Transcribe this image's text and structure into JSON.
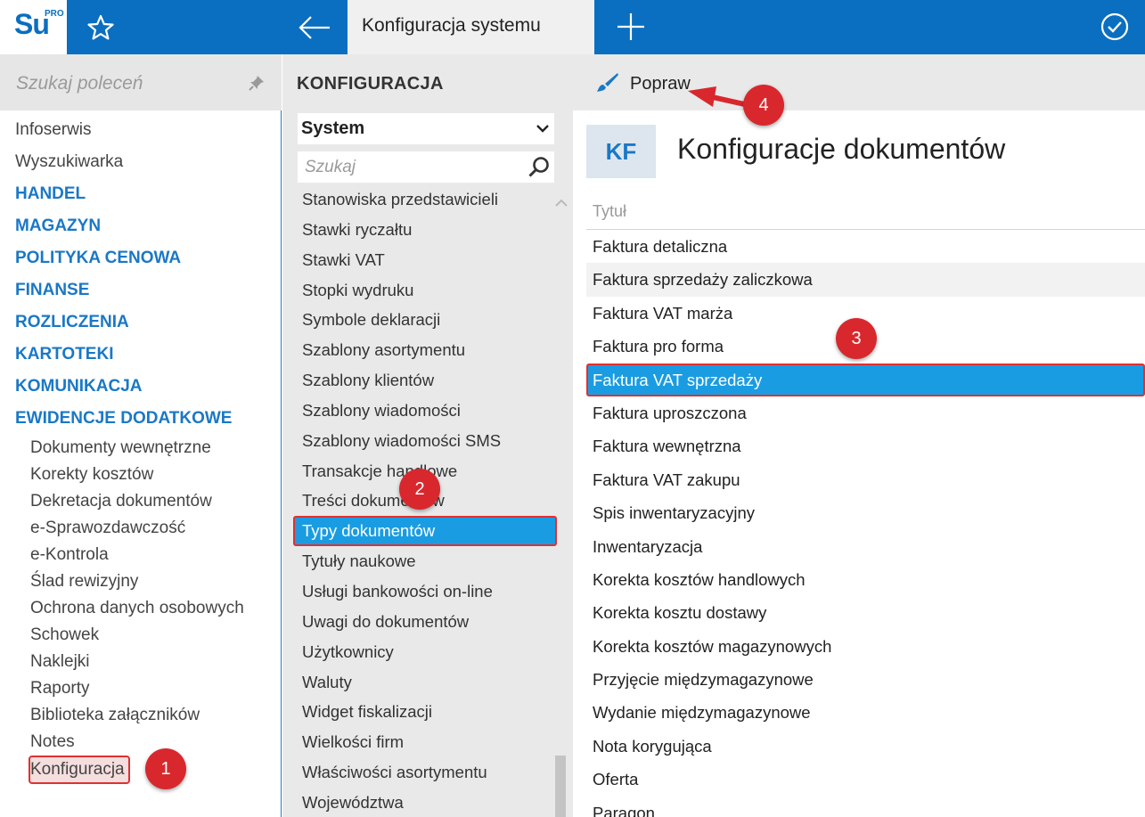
{
  "app": {
    "logo_text": "Su",
    "logo_sup": "PRO",
    "tab_title": "Konfiguracja systemu"
  },
  "icons": {
    "favorite": "star-icon",
    "back": "arrow-left-icon",
    "new_tab": "plus-icon",
    "status": "check-circle-icon",
    "pin": "pin-icon",
    "search": "magnifier-icon",
    "dropdown": "chevron-down-icon",
    "edit": "brush-icon",
    "scroll_up": "chevron-up-icon"
  },
  "colors": {
    "brand": "#0a6fc0",
    "accent": "#1a9ce2",
    "category": "#1a78c6",
    "callout": "#d8282d"
  },
  "sidebar": {
    "search_placeholder": "Szukaj poleceń",
    "items": [
      {
        "label": "Infoserwis",
        "type": "plain"
      },
      {
        "label": "Wyszukiwarka",
        "type": "plain"
      },
      {
        "label": "HANDEL",
        "type": "cat"
      },
      {
        "label": "MAGAZYN",
        "type": "cat"
      },
      {
        "label": "POLITYKA CENOWA",
        "type": "cat"
      },
      {
        "label": "FINANSE",
        "type": "cat"
      },
      {
        "label": "ROZLICZENIA",
        "type": "cat"
      },
      {
        "label": "KARTOTEKI",
        "type": "cat"
      },
      {
        "label": "KOMUNIKACJA",
        "type": "cat"
      },
      {
        "label": "EWIDENCJE DODATKOWE",
        "type": "cat"
      }
    ],
    "subitems": [
      "Dokumenty wewnętrzne",
      "Korekty kosztów",
      "Dekretacja dokumentów",
      "e-Sprawozdawczość",
      "e-Kontrola",
      "Ślad rewizyjny",
      "Ochrona danych osobowych",
      "Schowek",
      "Naklejki",
      "Raporty",
      "Biblioteka załączników",
      "Notes",
      "Konfiguracja"
    ]
  },
  "middle": {
    "title": "KONFIGURACJA",
    "select_value": "System",
    "search_placeholder": "Szukaj",
    "items": [
      "Stanowiska przedstawicieli",
      "Stawki ryczałtu",
      "Stawki VAT",
      "Stopki wydruku",
      "Symbole deklaracji",
      "Szablony asortymentu",
      "Szablony klientów",
      "Szablony wiadomości",
      "Szablony wiadomości SMS",
      "Transakcje handlowe",
      "Treści dokumentów",
      "Typy dokumentów",
      "Tytuły naukowe",
      "Usługi bankowości on-line",
      "Uwagi do dokumentów",
      "Użytkownicy",
      "Waluty",
      "Widget fiskalizacji",
      "Wielkości firm",
      "Właściwości asortymentu",
      "Województwa"
    ],
    "selected_index": 11
  },
  "right": {
    "toolbar_button": "Popraw",
    "badge": "KF",
    "title": "Konfiguracje dokumentów",
    "column_header": "Tytuł",
    "rows": [
      "Faktura detaliczna",
      "Faktura sprzedaży zaliczkowa",
      "Faktura VAT marża",
      "Faktura pro forma",
      "Faktura VAT sprzedaży",
      "Faktura uproszczona",
      "Faktura wewnętrzna",
      "Faktura VAT zakupu",
      "Spis inwentaryzacyjny",
      "Inwentaryzacja",
      "Korekta kosztów handlowych",
      "Korekta kosztu dostawy",
      "Korekta kosztów magazynowych",
      "Przyjęcie międzymagazynowe",
      "Wydanie międzymagazynowe",
      "Nota korygująca",
      "Oferta",
      "Paragon"
    ],
    "selected_index": 4
  },
  "callouts": [
    "1",
    "2",
    "3",
    "4"
  ]
}
